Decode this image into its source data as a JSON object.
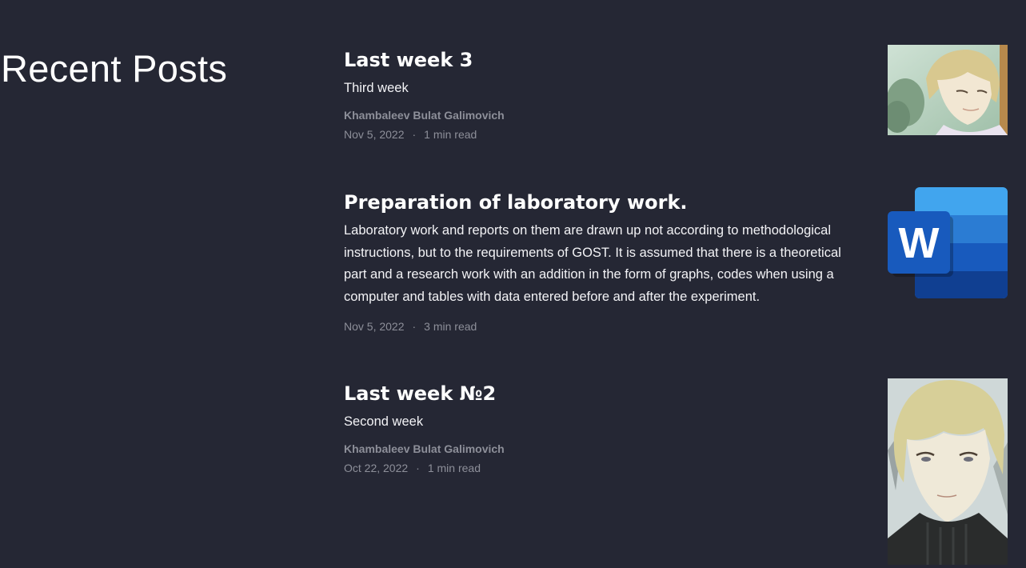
{
  "section": {
    "title": "Recent Posts"
  },
  "posts": [
    {
      "title": "Last week 3",
      "excerpt": "Third week",
      "author": "Khambaleev Bulat Galimovich",
      "date": "Nov 5, 2022",
      "separator": "·",
      "read_time": "1 min read",
      "thumbnail_icon": "anime-character-portrait"
    },
    {
      "title": "Preparation of laboratory work.",
      "excerpt": "Laboratory work and reports on them are drawn up not according to methodological instructions, but to the requirements of GOST. It is assumed that there is a theoretical part and a research work with an addition in the form of graphs, codes when using a computer and tables with data entered before and after the experiment.",
      "date": "Nov 5, 2022",
      "separator": "·",
      "read_time": "3 min read",
      "thumbnail_icon": "microsoft-word-logo",
      "thumbnail_letter": "W"
    },
    {
      "title": "Last week №2",
      "excerpt": "Second week",
      "author": "Khambaleev Bulat Galimovich",
      "date": "Oct 22, 2022",
      "separator": "·",
      "read_time": "1 min read",
      "thumbnail_icon": "anime-character-portrait"
    }
  ],
  "colors": {
    "background": "#252734",
    "text": "#ffffff",
    "muted": "#8d8f99",
    "word_blue": "#185abd"
  }
}
